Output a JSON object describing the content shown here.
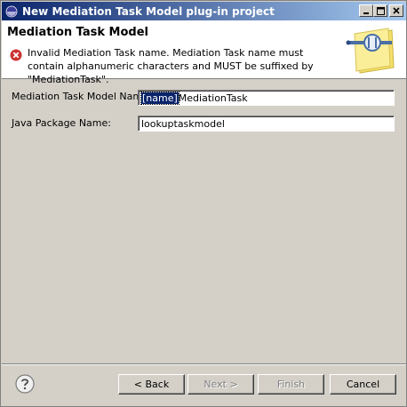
{
  "window": {
    "title": "New Mediation Task Model plug-in project",
    "controls": [
      "minimize",
      "maximize",
      "close"
    ]
  },
  "header": {
    "title": "Mediation Task Model",
    "error_message": "Invalid Mediation Task name. Mediation Task name must contain alphanumeric characters and MUST be suffixed by \"MediationTask\".",
    "error_icon": "error-icon",
    "banner_icon": "mediation-task-wizard-icon"
  },
  "form": {
    "task_name_label": "Mediation Task Model Name:",
    "task_name_selected": "[name]",
    "task_name_rest": "MediationTask",
    "package_label": "Java Package Name:",
    "package_value": "lookuptaskmodel"
  },
  "buttons": {
    "back": "< Back",
    "next": "Next >",
    "finish": "Finish",
    "cancel": "Cancel"
  },
  "colors": {
    "title_start": "#0a246a",
    "title_end": "#a6caf0",
    "error_red": "#cc3333"
  }
}
